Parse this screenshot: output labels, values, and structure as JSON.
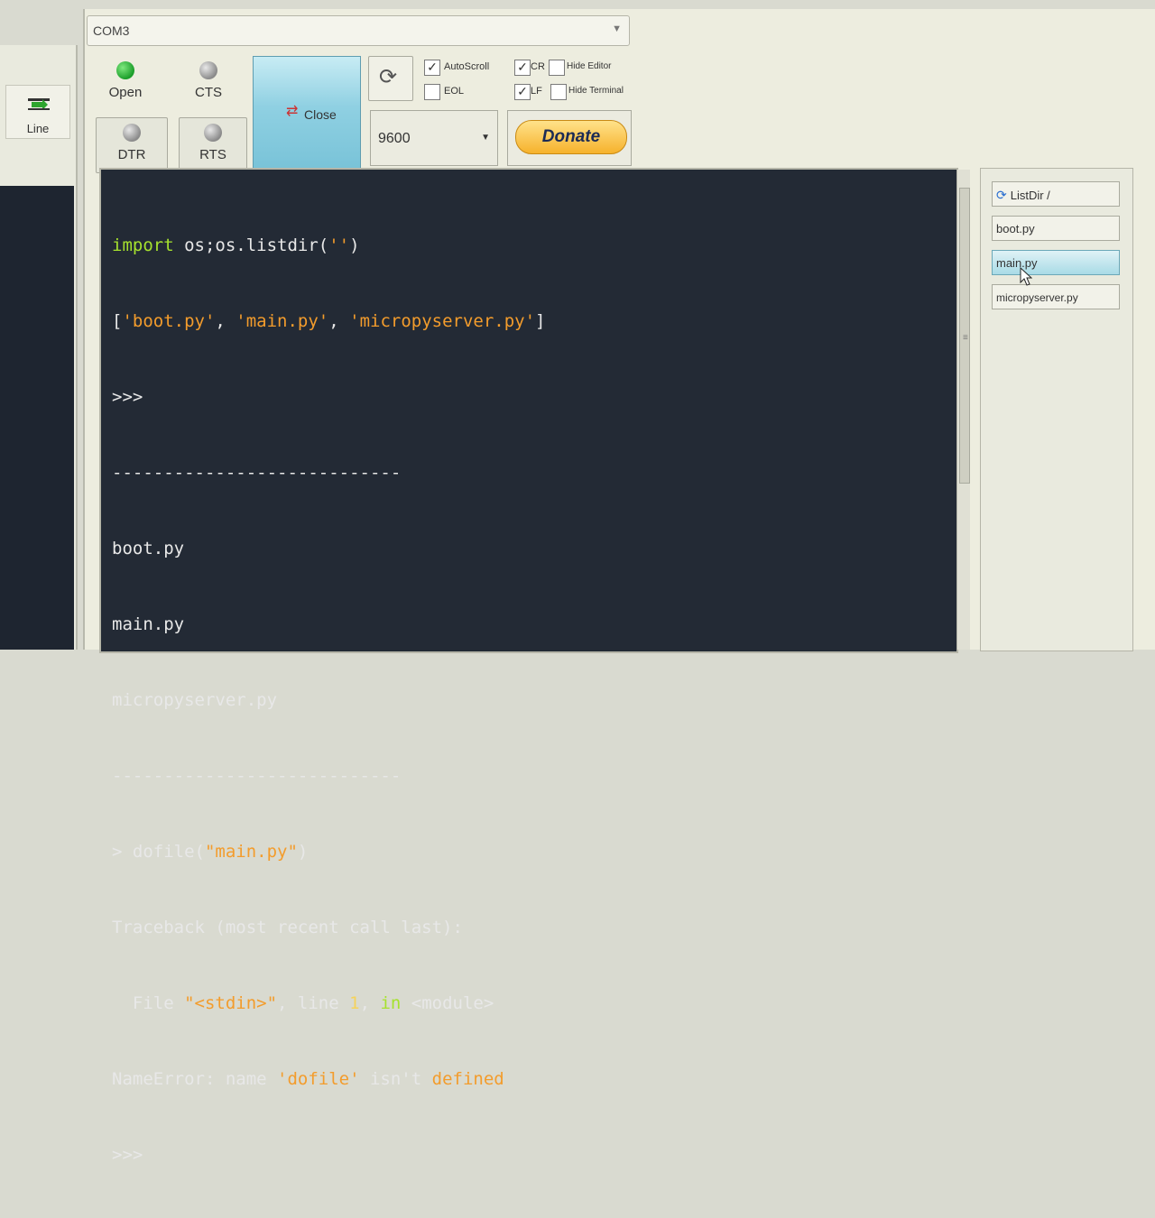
{
  "left_window": {
    "line_label": "Line"
  },
  "toolbar": {
    "port": "COM3",
    "open_label": "Open",
    "cts_label": "CTS",
    "dtr_label": "DTR",
    "rts_label": "RTS",
    "close_label": "Close",
    "checkboxes": {
      "autoscroll": "AutoScroll",
      "eol": "EOL",
      "cr": "CR",
      "lf": "LF",
      "hide_editor": "Hide Editor",
      "hide_terminal": "Hide Terminal"
    },
    "baud": "9600",
    "donate_label": "Donate"
  },
  "terminal": {
    "lines": [
      "import os;os.listdir('')",
      "['boot.py', 'main.py', 'micropyserver.py']",
      ">>>",
      "----------------------------",
      "boot.py",
      "main.py",
      "micropyserver.py",
      "----------------------------",
      "> dofile(\"main.py\")",
      "Traceback (most recent call last):",
      "  File \"<stdin>\", line 1, in <module>",
      "NameError: name 'dofile' isn't defined",
      ">>>"
    ]
  },
  "files": {
    "listdir_label": "ListDir /",
    "items": [
      "boot.py",
      "main.py",
      "micropyserver.py"
    ],
    "selected": "main.py"
  }
}
